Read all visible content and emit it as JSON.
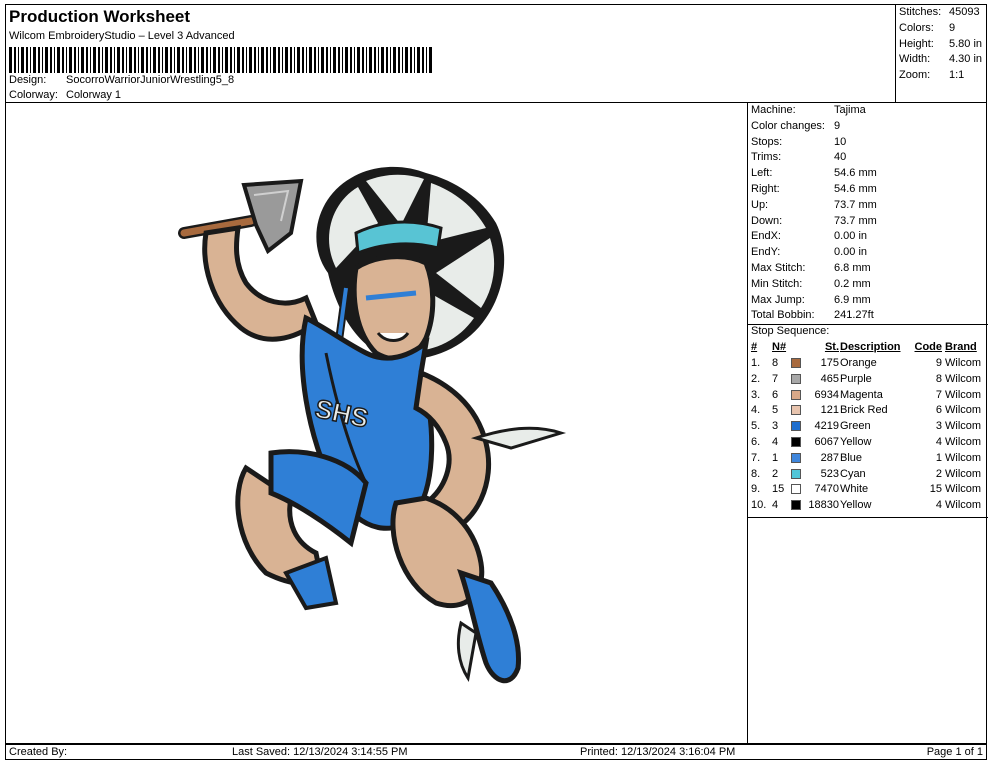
{
  "header": {
    "title": "Production Worksheet",
    "subtitle": "Wilcom EmbroideryStudio – Level 3 Advanced",
    "design_label": "Design:",
    "design_value": "SocorroWarriorJuniorWrestling5_8",
    "colorway_label": "Colorway:",
    "colorway_value": "Colorway 1"
  },
  "stats": [
    {
      "label": "Stitches:",
      "value": "45093"
    },
    {
      "label": "Colors:",
      "value": "9"
    },
    {
      "label": "Height:",
      "value": "5.80 in"
    },
    {
      "label": "Width:",
      "value": "4.30 in"
    },
    {
      "label": "Zoom:",
      "value": "1:1"
    }
  ],
  "machine": [
    {
      "label": "Machine:",
      "value": "Tajima"
    },
    {
      "label": "Color changes:",
      "value": "9"
    },
    {
      "label": "Stops:",
      "value": "10"
    },
    {
      "label": "Trims:",
      "value": "40"
    },
    {
      "label": "Left:",
      "value": "54.6 mm"
    },
    {
      "label": "Right:",
      "value": "54.6 mm"
    },
    {
      "label": "Up:",
      "value": "73.7 mm"
    },
    {
      "label": "Down:",
      "value": "73.7 mm"
    },
    {
      "label": "EndX:",
      "value": "0.00 in"
    },
    {
      "label": "EndY:",
      "value": "0.00 in"
    },
    {
      "label": "Max Stitch:",
      "value": "6.8 mm"
    },
    {
      "label": "Min Stitch:",
      "value": "0.2 mm"
    },
    {
      "label": "Max Jump:",
      "value": "6.9 mm"
    },
    {
      "label": "Total Bobbin:",
      "value": "241.27ft"
    }
  ],
  "stop_sequence": {
    "title": "Stop Sequence:",
    "headers": {
      "idx": "#",
      "n": "N#",
      "st": "St.",
      "desc": "Description",
      "code": "Code",
      "brand": "Brand"
    },
    "rows": [
      {
        "idx": "1.",
        "n": "8",
        "color": "#a86a3e",
        "st": "175",
        "desc": "Orange",
        "code": "9",
        "brand": "Wilcom"
      },
      {
        "idx": "2.",
        "n": "7",
        "color": "#a8a8a8",
        "st": "465",
        "desc": "Purple",
        "code": "8",
        "brand": "Wilcom"
      },
      {
        "idx": "3.",
        "n": "6",
        "color": "#d9a888",
        "st": "6934",
        "desc": "Magenta",
        "code": "7",
        "brand": "Wilcom"
      },
      {
        "idx": "4.",
        "n": "5",
        "color": "#e8c4ae",
        "st": "121",
        "desc": "Brick Red",
        "code": "6",
        "brand": "Wilcom"
      },
      {
        "idx": "5.",
        "n": "3",
        "color": "#1f6fcf",
        "st": "4219",
        "desc": "Green",
        "code": "3",
        "brand": "Wilcom"
      },
      {
        "idx": "6.",
        "n": "4",
        "color": "#000000",
        "st": "6067",
        "desc": "Yellow",
        "code": "4",
        "brand": "Wilcom"
      },
      {
        "idx": "7.",
        "n": "1",
        "color": "#3f86dc",
        "st": "287",
        "desc": "Blue",
        "code": "1",
        "brand": "Wilcom"
      },
      {
        "idx": "8.",
        "n": "2",
        "color": "#52c6d8",
        "st": "523",
        "desc": "Cyan",
        "code": "2",
        "brand": "Wilcom"
      },
      {
        "idx": "9.",
        "n": "15",
        "color": "#ffffff",
        "st": "7470",
        "desc": "White",
        "code": "15",
        "brand": "Wilcom"
      },
      {
        "idx": "10.",
        "n": "4",
        "color": "#000000",
        "st": "18830",
        "desc": "Yellow",
        "code": "4",
        "brand": "Wilcom"
      }
    ]
  },
  "artwork": {
    "jersey_text": "SHS",
    "colors": {
      "skin": "#d9b394",
      "jersey": "#2f7fd6",
      "outline": "#1a1a1a",
      "feather": "#e8ece9",
      "accent": "#58c4d4",
      "handle": "#a86a3e",
      "blade": "#9a9a9a"
    }
  },
  "footer": {
    "created_by": "Created By:",
    "last_saved": "Last Saved: 12/13/2024 3:14:55 PM",
    "printed": "Printed: 12/13/2024 3:16:04 PM",
    "page": "Page 1 of 1"
  }
}
